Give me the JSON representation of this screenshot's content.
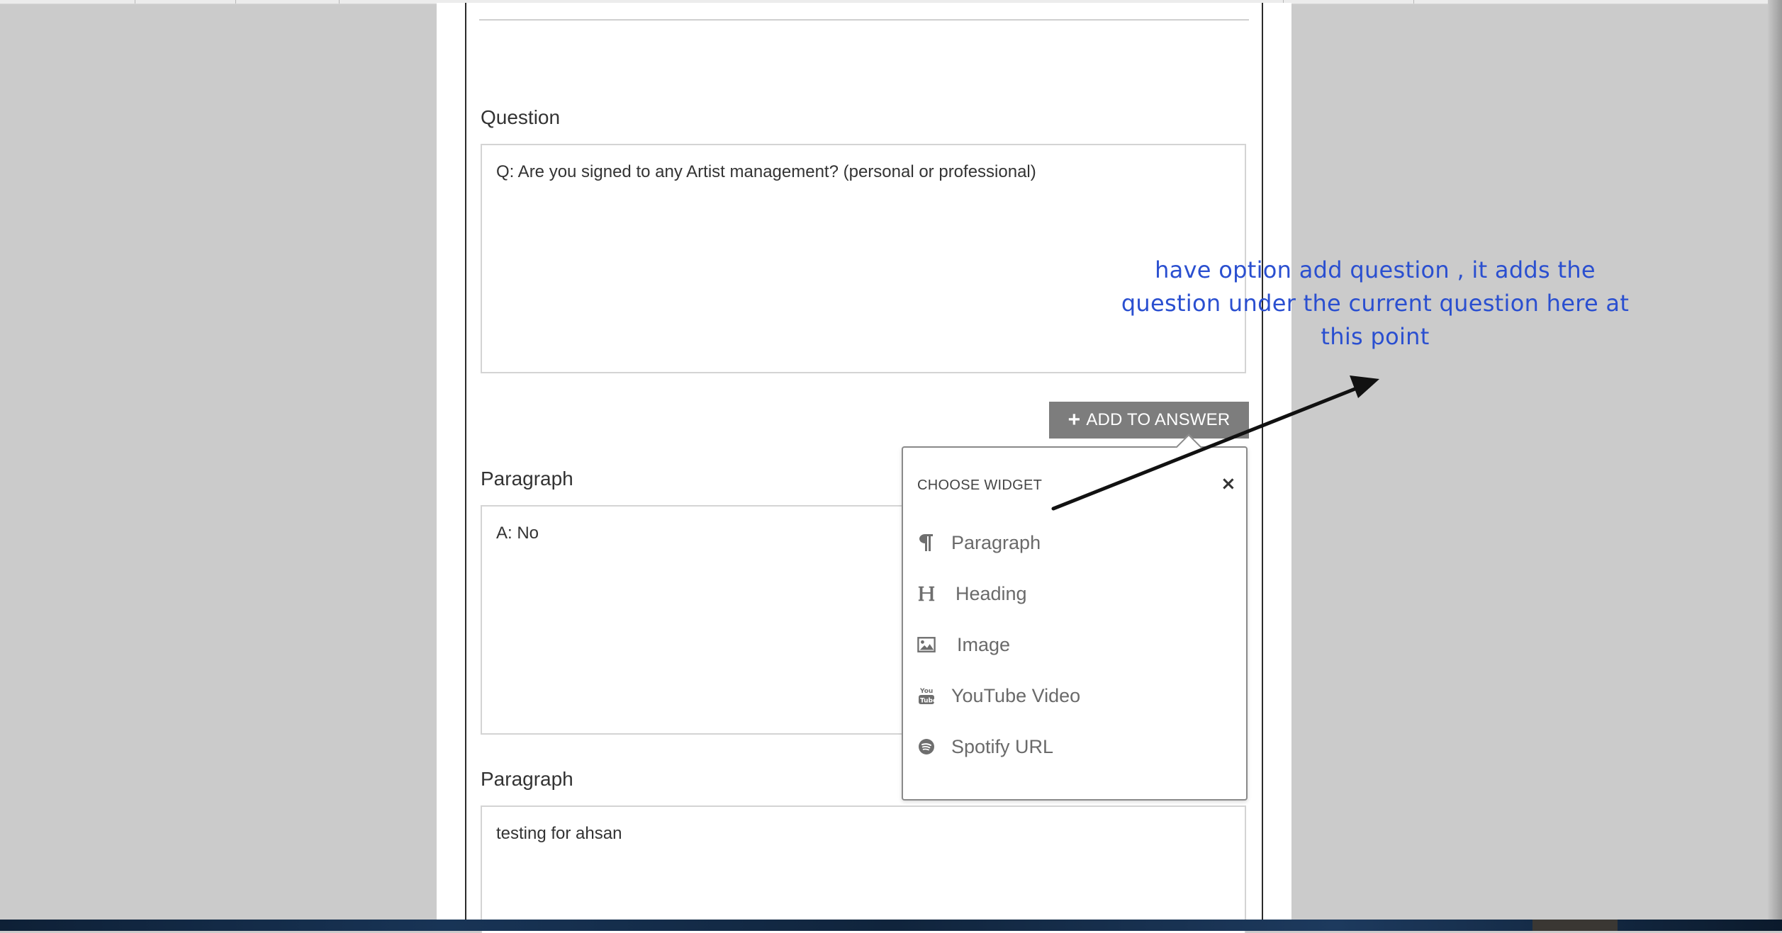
{
  "question": {
    "label": "Question",
    "value": "Q: Are you signed to any Artist management? (personal or professional)"
  },
  "add_answer_button": {
    "icon": "+",
    "label": "ADD TO ANSWER"
  },
  "paragraph_1": {
    "label": "Paragraph",
    "value": "A: No"
  },
  "paragraph_2": {
    "label": "Paragraph",
    "value": "testing for ahsan"
  },
  "widget_popup": {
    "title": "CHOOSE WIDGET",
    "close": "×",
    "items": [
      {
        "label": "Paragraph",
        "icon": "pilcrow-icon"
      },
      {
        "label": "Heading",
        "icon": "heading-icon"
      },
      {
        "label": "Image",
        "icon": "image-icon"
      },
      {
        "label": "YouTube Video",
        "icon": "youtube-icon"
      },
      {
        "label": "Spotify URL",
        "icon": "spotify-icon"
      }
    ]
  },
  "annotation": {
    "lines": [
      "have option add question , it adds the",
      "question under the current  question here at",
      "this point"
    ],
    "color": "#2a4fd0"
  },
  "colors": {
    "button_bg": "#7d7d7d",
    "backdrop": "#cbcbcb"
  }
}
